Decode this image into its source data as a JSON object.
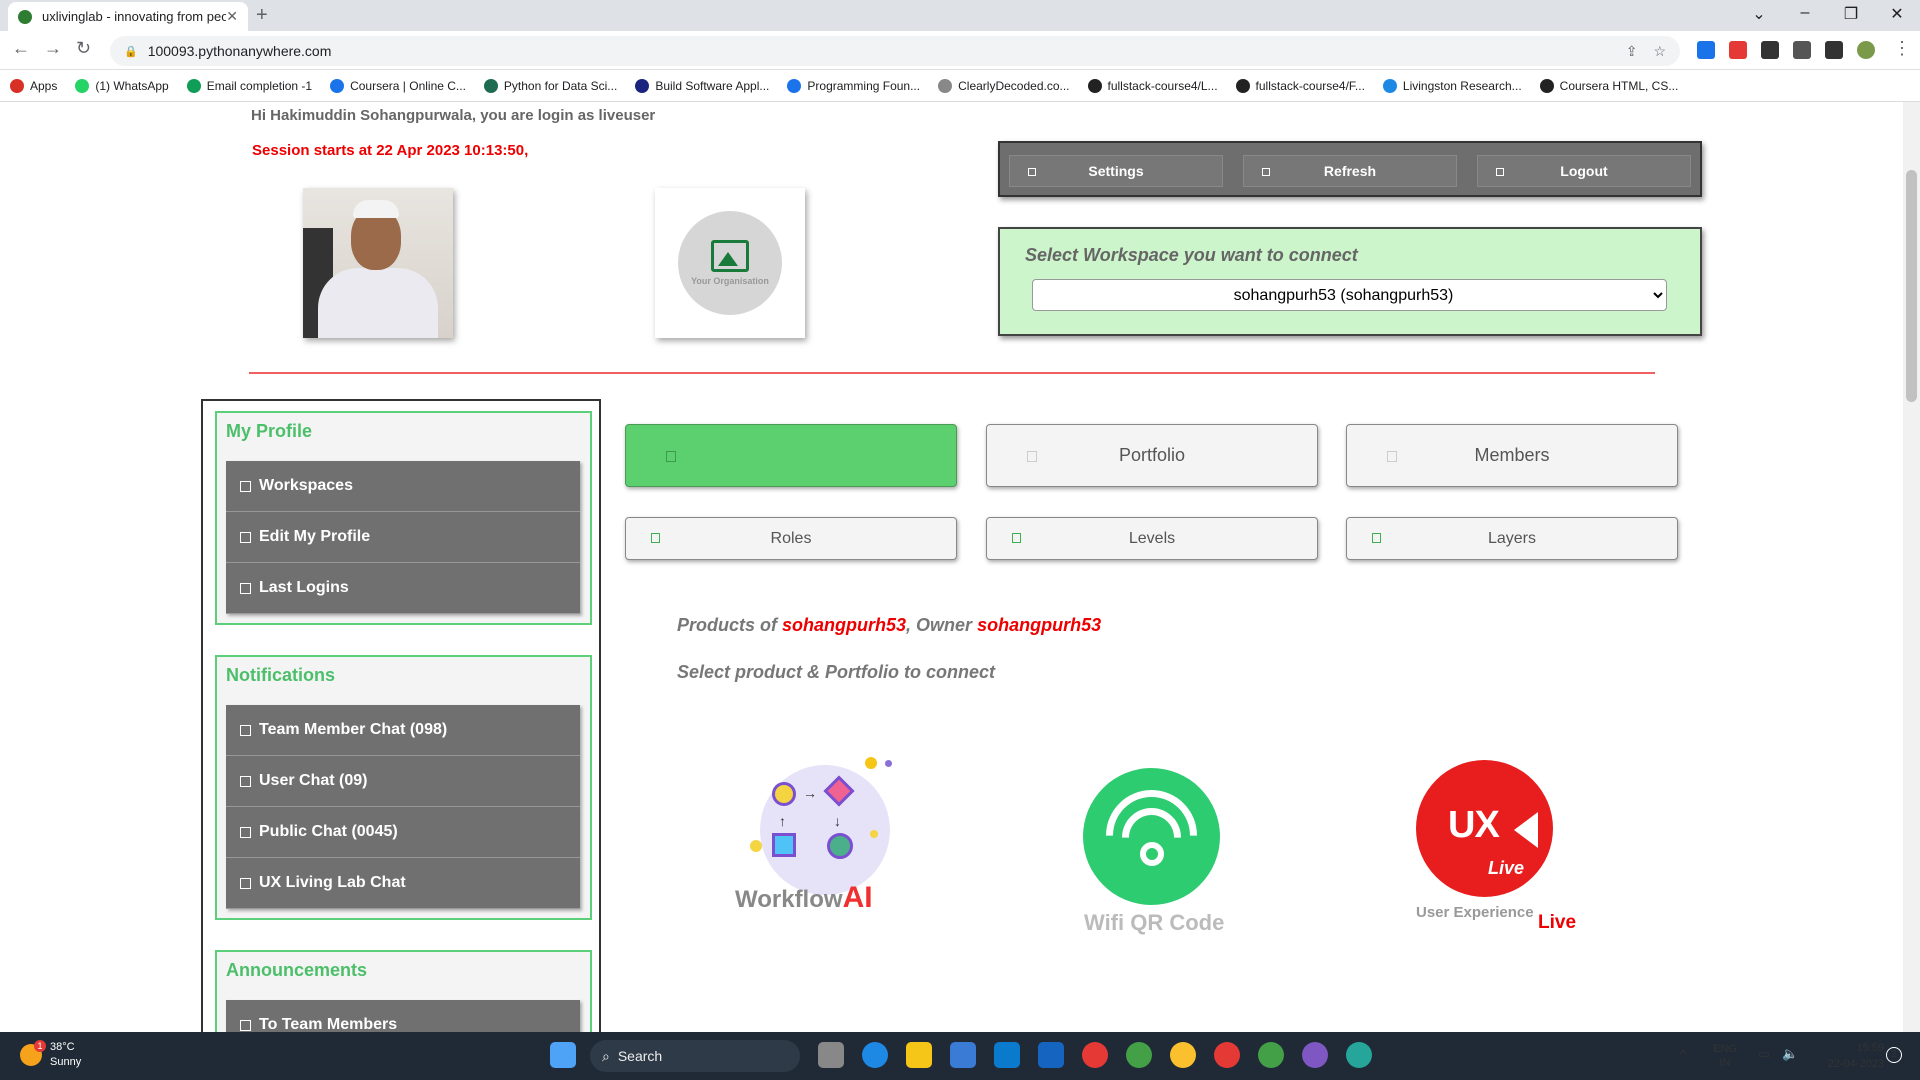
{
  "browser": {
    "tab_title": "uxlivinglab - innovating from peo",
    "url": "100093.pythonanywhere.com",
    "bookmarks": [
      {
        "label": "Apps",
        "color": "#d93025"
      },
      {
        "label": "(1) WhatsApp",
        "color": "#25d366"
      },
      {
        "label": "Email completion -1",
        "color": "#0f9d58"
      },
      {
        "label": "Coursera | Online C...",
        "color": "#1a73e8"
      },
      {
        "label": "Python for Data Sci...",
        "color": "#1e6b52"
      },
      {
        "label": "Build Software Appl...",
        "color": "#1a237e"
      },
      {
        "label": "Programming Foun...",
        "color": "#1a73e8"
      },
      {
        "label": "ClearlyDecoded.co...",
        "color": "#888888"
      },
      {
        "label": "fullstack-course4/L...",
        "color": "#222222"
      },
      {
        "label": "fullstack-course4/F...",
        "color": "#222222"
      },
      {
        "label": "Livingston Research...",
        "color": "#1e88e5"
      },
      {
        "label": "Coursera HTML, CS...",
        "color": "#222222"
      }
    ]
  },
  "header": {
    "greeting": "Hi Hakimuddin Sohangpurwala, you are login as liveuser",
    "session": "Session starts at 22 Apr 2023 10:13:50,",
    "org_placeholder": "Your Organisation"
  },
  "controls": {
    "settings": "Settings",
    "refresh": "Refresh",
    "logout": "Logout"
  },
  "workspace": {
    "label": "Select Workspace you want to connect",
    "selected": "sohangpurh53 (sohangpurh53)"
  },
  "sidebar": {
    "profile": {
      "title": "My Profile",
      "items": [
        "Workspaces",
        "Edit My Profile",
        "Last Logins"
      ]
    },
    "notifications": {
      "title": "Notifications",
      "items": [
        "Team Member Chat (098)",
        "User Chat (09)",
        "Public Chat (0045)",
        "UX Living Lab Chat"
      ]
    },
    "announcements": {
      "title": "Announcements",
      "items": [
        "To Team Members"
      ]
    }
  },
  "main": {
    "big_buttons": [
      "",
      "Portfolio",
      "Members"
    ],
    "small_buttons": [
      "Roles",
      "Levels",
      "Layers"
    ],
    "products_prefix": "Products of",
    "products_workspace": "sohangpurh53",
    "owner_prefix": ", Owner",
    "owner_name": "sohangpurh53",
    "select_hint": "Select product & Portfolio to connect",
    "products": [
      {
        "name": "Workflow",
        "suffix": "AI"
      },
      {
        "name": "Wifi QR Code"
      },
      {
        "name": "User Experience",
        "badge": "UX",
        "suffix": "Live"
      }
    ]
  },
  "taskbar": {
    "temperature": "38°C",
    "weather": "Sunny",
    "weather_badge": "1",
    "search": "Search",
    "lang1": "ENG",
    "lang2": "IN",
    "time": "15:59",
    "date": "22-04-2023",
    "notif_count": "2"
  }
}
